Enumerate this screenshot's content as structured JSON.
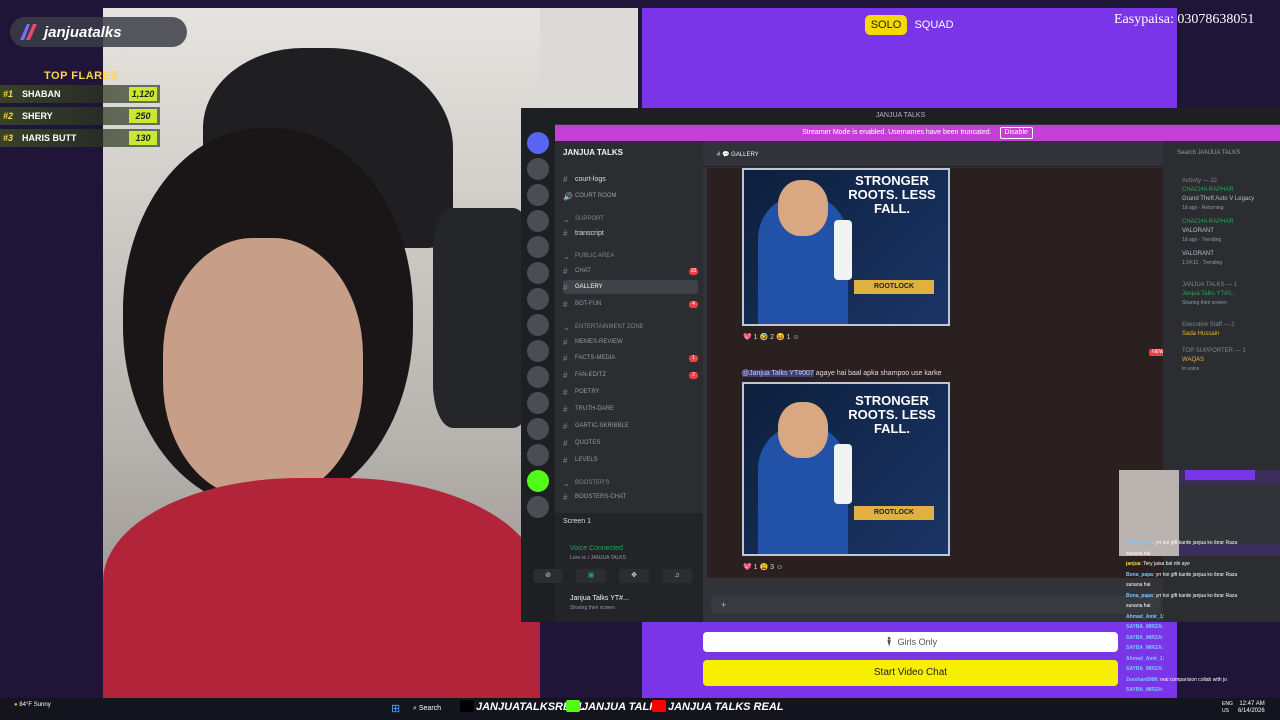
{
  "brand": {
    "name": "janjuatalks"
  },
  "flares": {
    "title": "TOP FLARES",
    "rows": [
      {
        "rank": "#1",
        "name": "SHABAN",
        "score": "1,120"
      },
      {
        "rank": "#2",
        "name": "SHERY",
        "score": "250"
      },
      {
        "rank": "#3",
        "name": "HARIS BUTT",
        "score": "130"
      }
    ]
  },
  "video_chat": {
    "modes": {
      "solo": "SOLO",
      "squad": "SQUAD"
    },
    "donation": "Easypaisa: 03078638051",
    "girls_only": "🕴 Girls Only",
    "start_button": "Start Video Chat"
  },
  "discord": {
    "window_title": "JANJUA TALKS",
    "banner": "Streamer Mode is enabled. Usernames have been truncated.",
    "disable_label": "Disable",
    "server_name": "JANJUA TALKS",
    "channels": [
      {
        "label": "court-logs",
        "kind": "plain"
      },
      {
        "label": "Court room",
        "kind": "voice"
      },
      {
        "label": "SUPPORT",
        "kind": "cat"
      },
      {
        "label": "transcript",
        "kind": "plain"
      },
      {
        "label": "PUBLIC AREA",
        "kind": "cat"
      },
      {
        "label": "chat",
        "kind": "text",
        "badge": "33"
      },
      {
        "label": "gallery",
        "kind": "active"
      },
      {
        "label": "bot-fun",
        "kind": "text",
        "badge": "4"
      },
      {
        "label": "ENTERTAINMENT ZONE",
        "kind": "cat"
      },
      {
        "label": "memes-review",
        "kind": "text"
      },
      {
        "label": "facts-media",
        "kind": "text",
        "badge": "1"
      },
      {
        "label": "fan-editz",
        "kind": "text",
        "badge": "2"
      },
      {
        "label": "poetry",
        "kind": "text"
      },
      {
        "label": "truth-dare",
        "kind": "text"
      },
      {
        "label": "gartic-skribble",
        "kind": "text"
      },
      {
        "label": "quotes",
        "kind": "text"
      },
      {
        "label": "levels",
        "kind": "text"
      },
      {
        "label": "BOOSTER'S",
        "kind": "cat"
      },
      {
        "label": "boosters-chat",
        "kind": "text"
      }
    ],
    "screen_label": "Screen 1",
    "voice_status": "Voice Connected",
    "voice_sub": "Lore vc / JANJUA TALKS",
    "user_name": "Janjua Talks YT#...",
    "user_status": "Sharing their screen",
    "channel_header": "GALLERY",
    "ad": {
      "title": "STRONGER ROOTS. LESS FALL.",
      "logo": "ROOTLOCK"
    },
    "reactions_1": "💖 1   🤣 2   😆 1   ☺",
    "reactions_2": "💖 1   😩 3   ☺",
    "message_author": "@Janjua Talks YT#007",
    "message_text": "agaye hai baal apka shampoo use karke",
    "new_label": "NEW",
    "search_placeholder": "Search JANJUA TALKS",
    "members": [
      {
        "text": "Activity — 22",
        "kind": "cat"
      },
      {
        "text": "CHACHA RAPHAR",
        "kind": "name"
      },
      {
        "text": "Grand Theft Auto V Legacy",
        "kind": "plain"
      },
      {
        "text": "1d ago · Returning",
        "kind": "sub"
      },
      {
        "text": "CHACHA RAPHAR",
        "kind": "name"
      },
      {
        "text": "VALORANT",
        "kind": "plain"
      },
      {
        "text": "1d ago · Trending",
        "kind": "sub"
      },
      {
        "text": "VALORANT",
        "kind": "plain"
      },
      {
        "text": "1:24:11 · Trending",
        "kind": "sub"
      },
      {
        "text": "JANJUA TALKS — 1",
        "kind": "cat"
      },
      {
        "text": "Janjua Talks YT#0...",
        "kind": "name"
      },
      {
        "text": "Sharing their screen",
        "kind": "sub"
      },
      {
        "text": "Executive Staff — 2",
        "kind": "cat"
      },
      {
        "text": "Sada Hussain",
        "kind": "gold"
      },
      {
        "text": "TOP SUPPORTER — 1",
        "kind": "cat"
      },
      {
        "text": "WAQAS",
        "kind": "gold"
      },
      {
        "text": "In voice",
        "kind": "sub"
      }
    ]
  },
  "live_chat": [
    {
      "user": "Bona_papa",
      "msg": ": yrr koi gift karde janjua ko ibrar Raza",
      "gold": false
    },
    {
      "user": "",
      "msg": "sunana hai",
      "gold": false
    },
    {
      "user": "janjua",
      "msg": ": Tery jaisa bal nhi aye",
      "gold": true
    },
    {
      "user": "Bona_papa",
      "msg": ": yrr koi gift karde janjua ko ibrar Raza",
      "gold": false
    },
    {
      "user": "",
      "msg": "sunana hai",
      "gold": false
    },
    {
      "user": "Bona_papa",
      "msg": ": yrr koi gift karde janjua ko ibrar Raza",
      "gold": false
    },
    {
      "user": "",
      "msg": "sunana hai",
      "gold": false
    },
    {
      "user": "Ahmad_Amir_1",
      "msg": ":",
      "gold": false
    },
    {
      "user": "SAYBA_MIRZA",
      "msg": ":",
      "gold": false
    },
    {
      "user": "SAYBA_MIRZA",
      "msg": ":",
      "gold": false
    },
    {
      "user": "SAYBA_MIRZA",
      "msg": ":",
      "gold": false
    },
    {
      "user": "Ahmad_Amir_1",
      "msg": ":",
      "gold": false
    },
    {
      "user": "SAYBA_MIRZA",
      "msg": ":",
      "gold": false
    },
    {
      "user": "Zeeshan8986",
      "msg": ": real comparision collab with jo",
      "gold": false
    },
    {
      "user": "SAYBA_MIRZA",
      "msg": ":",
      "gold": false
    }
  ],
  "taskbar": {
    "weather_temp": "84°F",
    "weather_desc": "Sunny",
    "search": "Search",
    "x_handle": "JANJUATALKSREAL",
    "kick_handle": "JANJUA TALKS",
    "yt_handle": "JANJUA TALKS REAL",
    "lang_1": "ENG",
    "lang_2": "US",
    "time": "12:47 AM",
    "date": "6/14/2026"
  },
  "colors": {
    "discord_bg": "#313338",
    "accent_purple": "#7a35e8",
    "button_yellow": "#f7ee00",
    "flare_green": "#c9e832"
  }
}
